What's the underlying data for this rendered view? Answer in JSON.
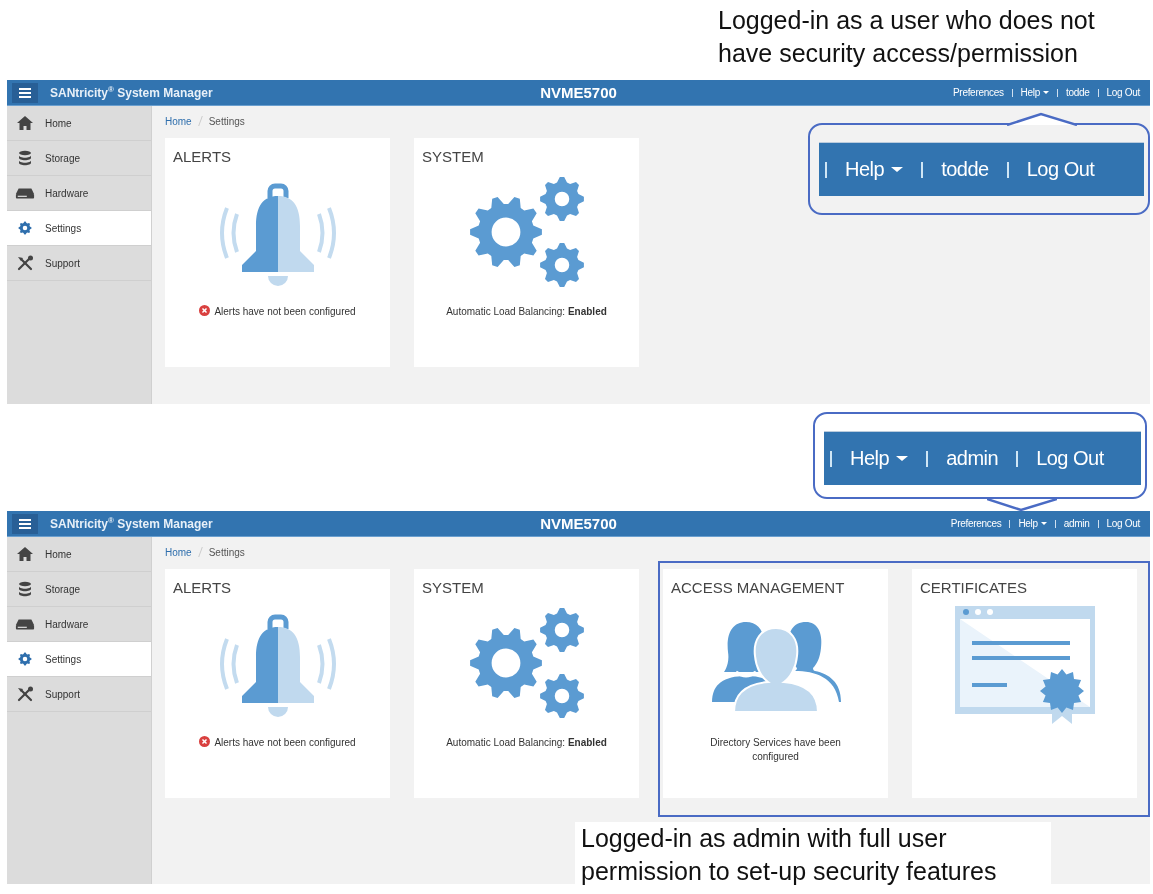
{
  "screens": [
    {
      "caption": "Logged-in as a user who does not have security access/permission",
      "highlight": false,
      "header": {
        "product": "SANtricity$^{®}$ System Manager",
        "system": "NVME5700",
        "links": [
          {
            "label": "Preferences",
            "dropdown": false
          },
          {
            "label": "Help",
            "dropdown": true
          },
          {
            "label": "todde",
            "dropdown": false
          },
          {
            "label": "Log Out",
            "dropdown": false
          }
        ]
      },
      "callout": {
        "items": [
          {
            "label": "Help",
            "dropdown": true
          },
          {
            "label": "todde",
            "dropdown": false
          },
          {
            "label": "Log Out",
            "dropdown": false
          }
        ]
      },
      "sidebar": [
        {
          "label": "Home",
          "kind": "home",
          "selected": false
        },
        {
          "label": "Storage",
          "kind": "storage",
          "selected": false
        },
        {
          "label": "Hardware",
          "kind": "hardware",
          "selected": false
        },
        {
          "label": "Settings",
          "kind": "settings",
          "selected": true
        },
        {
          "label": "Support",
          "kind": "support",
          "selected": false
        }
      ],
      "breadcrumb": [
        {
          "label": "Home",
          "current": false
        },
        {
          "label": "Settings",
          "current": true
        }
      ],
      "cards": [
        {
          "title": "ALERTS",
          "kind": "bell",
          "status": "Alerts have not been configured",
          "error": true
        },
        {
          "title": "SYSTEM",
          "kind": "gears",
          "status": "Automatic Load Balancing: **Enabled**",
          "error": false
        }
      ]
    },
    {
      "caption": "Logged-in as admin with full user permission to set-up security features",
      "highlight": true,
      "header": {
        "product": "SANtricity$^{®}$ System Manager",
        "system": "NVME5700",
        "links": [
          {
            "label": "Preferences",
            "dropdown": false
          },
          {
            "label": "Help",
            "dropdown": true
          },
          {
            "label": "admin",
            "dropdown": false
          },
          {
            "label": "Log Out",
            "dropdown": false
          }
        ]
      },
      "callout": {
        "items": [
          {
            "label": "Help",
            "dropdown": true
          },
          {
            "label": "admin",
            "dropdown": false
          },
          {
            "label": "Log Out",
            "dropdown": false
          }
        ]
      },
      "sidebar": [
        {
          "label": "Home",
          "kind": "home",
          "selected": false
        },
        {
          "label": "Storage",
          "kind": "storage",
          "selected": false
        },
        {
          "label": "Hardware",
          "kind": "hardware",
          "selected": false
        },
        {
          "label": "Settings",
          "kind": "settings",
          "selected": true
        },
        {
          "label": "Support",
          "kind": "support",
          "selected": false
        }
      ],
      "breadcrumb": [
        {
          "label": "Home",
          "current": false
        },
        {
          "label": "Settings",
          "current": true
        }
      ],
      "cards": [
        {
          "title": "ALERTS",
          "kind": "bell",
          "status": "Alerts have not been configured",
          "error": true
        },
        {
          "title": "SYSTEM",
          "kind": "gears",
          "status": "Automatic Load Balancing: **Enabled**",
          "error": false
        },
        {
          "title": "ACCESS MANAGEMENT",
          "kind": "people",
          "status": "Directory Services have been configured",
          "error": false
        },
        {
          "title": "CERTIFICATES",
          "kind": "certificate"
        }
      ]
    }
  ]
}
